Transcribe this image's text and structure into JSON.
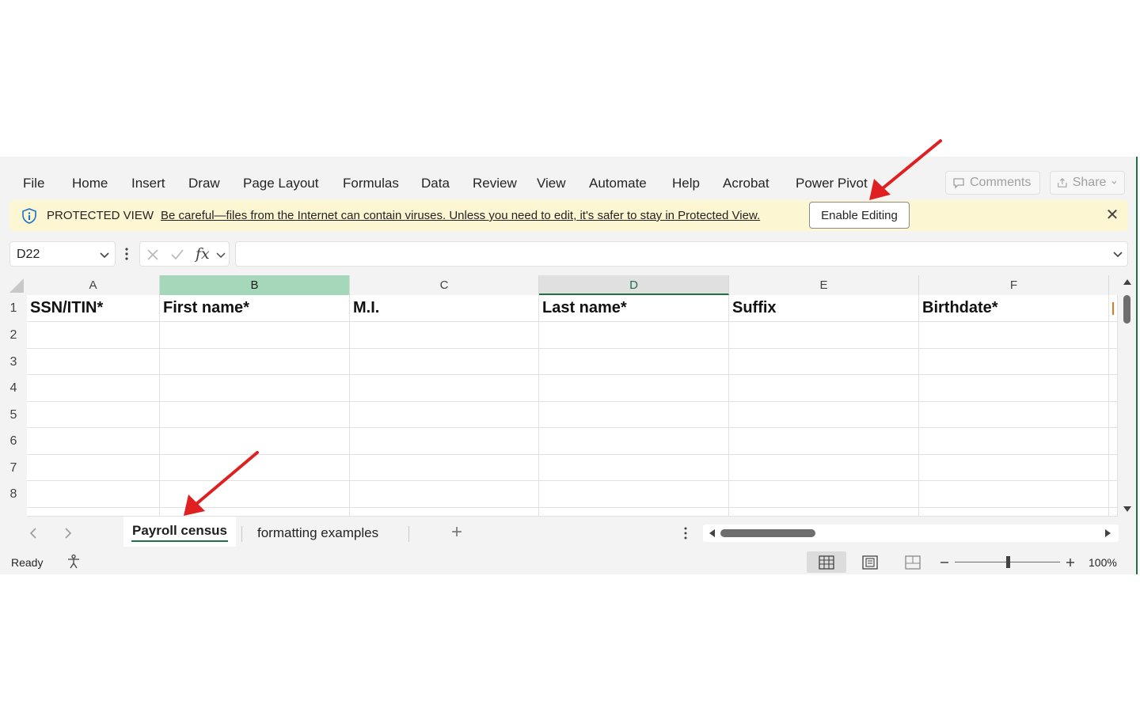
{
  "menu": {
    "items": [
      "File",
      "Home",
      "Insert",
      "Draw",
      "Page Layout",
      "Formulas",
      "Data",
      "Review",
      "View",
      "Automate",
      "Help",
      "Acrobat",
      "Power Pivot"
    ],
    "comments_label": "Comments",
    "share_label": "Share"
  },
  "protected_view": {
    "title": "PROTECTED VIEW",
    "message": "Be careful—files from the Internet can contain viruses. Unless you need to edit, it's safer to stay in Protected View.",
    "button_label": "Enable Editing",
    "close_glyph": "✕"
  },
  "formula_bar": {
    "name_box": "D22",
    "fx_label": "fx",
    "formula_value": ""
  },
  "grid": {
    "columns": [
      "A",
      "B",
      "C",
      "D",
      "E",
      "F"
    ],
    "rows": [
      "1",
      "2",
      "3",
      "4",
      "5",
      "6",
      "7",
      "8"
    ],
    "header_cells": [
      "SSN/ITIN*",
      "First name*",
      "M.I.",
      "Last name*",
      "Suffix",
      "Birthdate*"
    ],
    "selected_column": "D",
    "highlighted_column": "B"
  },
  "sheet_tabs": {
    "tabs": [
      "Payroll census",
      "formatting examples"
    ],
    "active": "Payroll census",
    "add_glyph": "+"
  },
  "status_bar": {
    "status": "Ready",
    "zoom": "100%"
  },
  "colors": {
    "accent_green": "#1e7145",
    "selection_green": "#a5d8ba",
    "protected_yellow": "#fdf6d3",
    "annotation_red": "#e02020"
  }
}
